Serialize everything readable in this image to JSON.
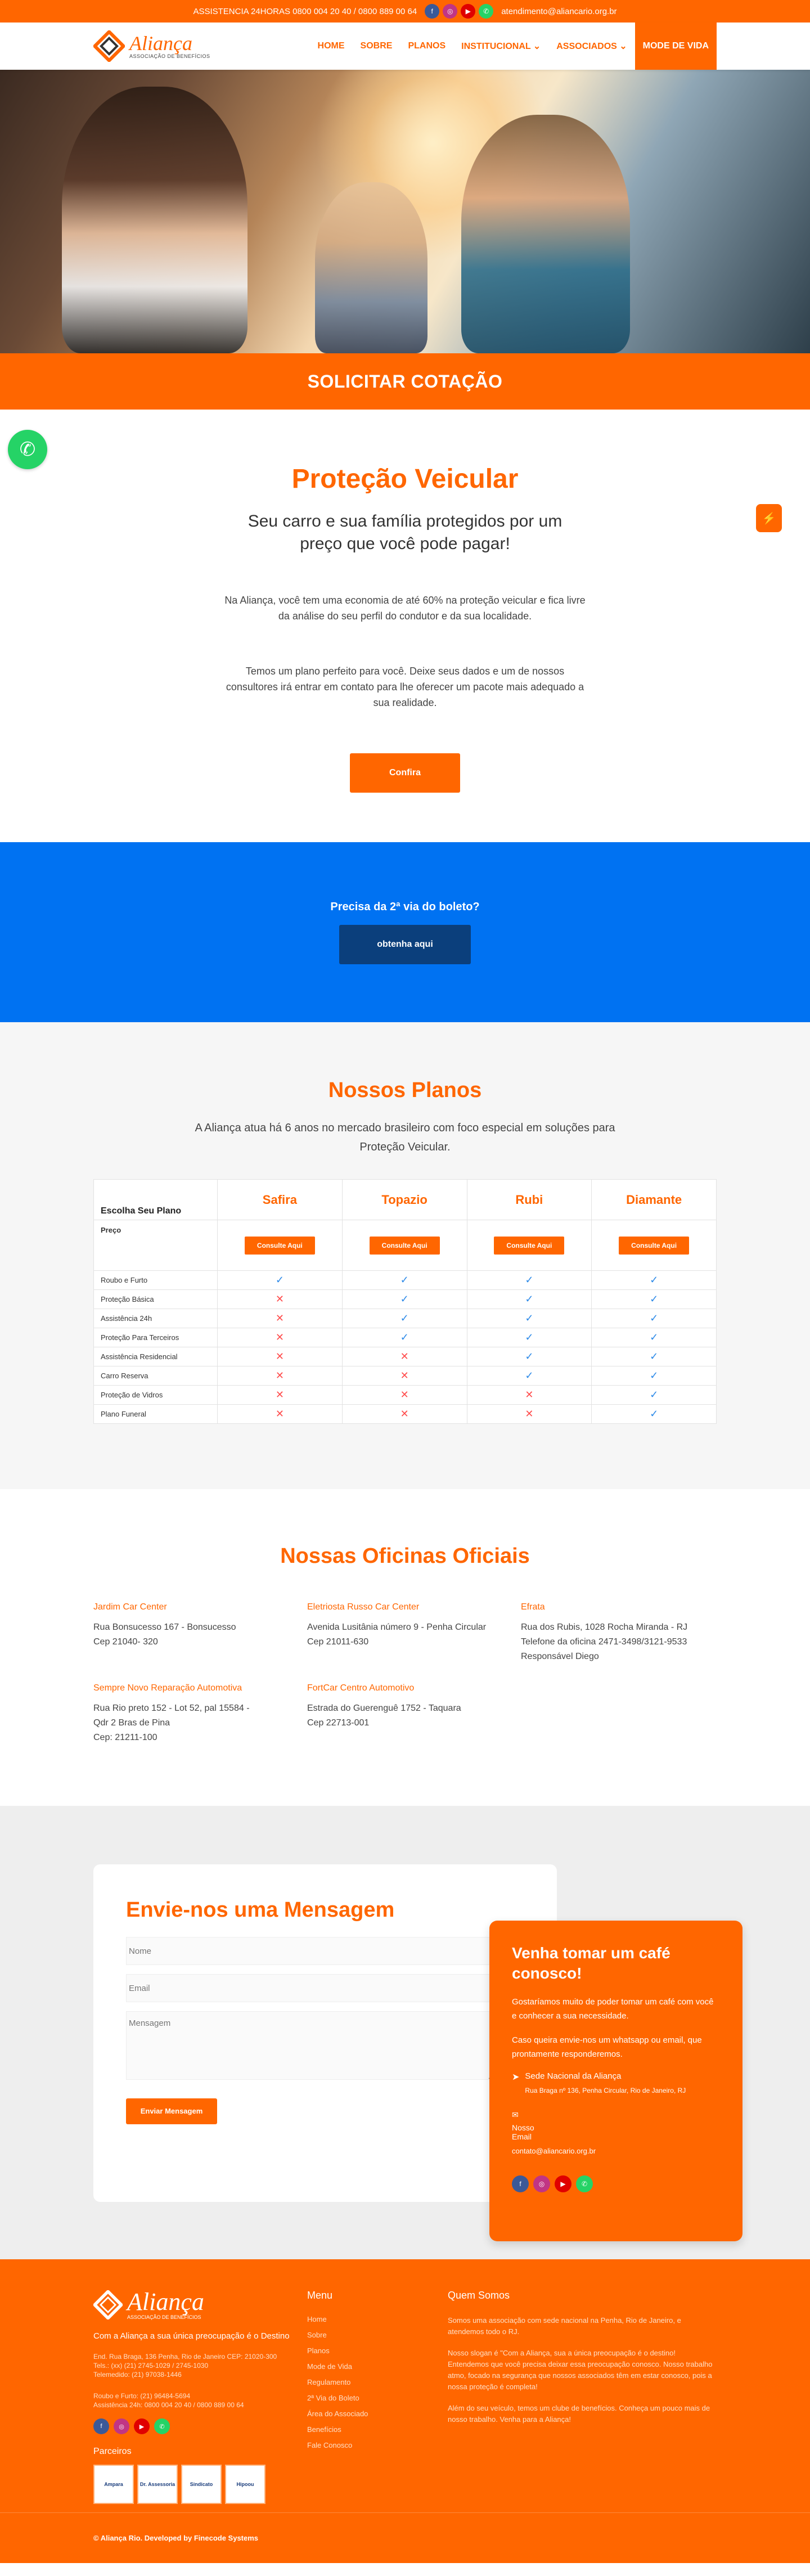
{
  "topbar": {
    "assistance": "ASSISTENCIA 24HORAS 0800 004 20 40 / 0800 889 00 64",
    "email": "atendimento@aliancario.org.br",
    "social": [
      {
        "icon": "facebook-icon",
        "color": "#3b5998"
      },
      {
        "icon": "instagram-icon",
        "color": "#c13584"
      },
      {
        "icon": "youtube-icon",
        "color": "#e00000"
      },
      {
        "icon": "whatsapp-icon",
        "color": "#25d366"
      }
    ]
  },
  "logo": {
    "name": "Aliança",
    "tagline": "ASSOCIAÇÃO DE BENEFÍCIOS"
  },
  "nav": [
    {
      "label": "HOME"
    },
    {
      "label": "SOBRE"
    },
    {
      "label": "PLANOS"
    },
    {
      "label": "INSTITUCIONAL ⌄"
    },
    {
      "label": "ASSOCIADOS ⌄"
    },
    {
      "label": "MODE DE VIDA"
    }
  ],
  "cta": {
    "label": "SOLICITAR COTAÇÃO"
  },
  "intro": {
    "title": "Proteção Veicular",
    "subtitle": "Seu carro e sua família protegidos por um preço que você pode pagar!",
    "p1": "Na Aliança, você tem uma economia de até 60% na proteção veicular e fica livre da análise do seu perfil do condutor e da sua localidade.",
    "p2": "Temos um plano perfeito para você. Deixe seus dados e um de nossos consultores irá entrar em contato para lhe oferecer um pacote mais adequado a sua realidade.",
    "button": "Confira"
  },
  "boleto": {
    "title": "Precisa da 2ª via do boleto?",
    "button": "obtenha aqui"
  },
  "planos": {
    "title": "Nossos Planos",
    "subtitle": "A Aliança atua há 6 anos no mercado brasileiro com foco especial em soluções para Proteção Veicular.",
    "choose_label": "Escolha Seu Plano",
    "price_label": "Preço",
    "button": "Consulte Aqui",
    "plans": [
      "Safira",
      "Topazio",
      "Rubi",
      "Diamante"
    ],
    "features": [
      {
        "name": "Roubo e Furto",
        "v": [
          1,
          1,
          1,
          1
        ]
      },
      {
        "name": "Proteção Básica",
        "v": [
          0,
          1,
          1,
          1
        ]
      },
      {
        "name": "Assistência 24h",
        "v": [
          0,
          1,
          1,
          1
        ]
      },
      {
        "name": "Proteção Para Terceiros",
        "v": [
          0,
          1,
          1,
          1
        ]
      },
      {
        "name": "Assistência Residencial",
        "v": [
          0,
          0,
          1,
          1
        ]
      },
      {
        "name": "Carro Reserva",
        "v": [
          0,
          0,
          1,
          1
        ]
      },
      {
        "name": "Proteção de Vidros",
        "v": [
          0,
          0,
          0,
          1
        ]
      },
      {
        "name": "Plano Funeral",
        "v": [
          0,
          0,
          0,
          1
        ]
      }
    ]
  },
  "oficinas": {
    "title": "Nossas Oficinas Oficiais",
    "items": [
      {
        "name": "Jardim Car Center",
        "lines": [
          "Rua Bonsucesso 167 - Bonsucesso",
          "Cep 21040- 320"
        ]
      },
      {
        "name": "Eletriosta Russo Car Center",
        "lines": [
          "Avenida Lusitânia número 9 - Penha Circular",
          "Cep 21011-630"
        ]
      },
      {
        "name": "Efrata",
        "lines": [
          "Rua dos Rubis, 1028 Rocha Miranda - RJ",
          "Telefone da oficina 2471-3498/3121-9533",
          "Responsável Diego"
        ]
      },
      {
        "name": "Sempre Novo Reparação Automotiva",
        "lines": [
          "Rua Rio preto 152 - Lot 52, pal 15584 - Qdr 2 Bras de Pina",
          "Cep: 21211-100"
        ]
      },
      {
        "name": "FortCar Centro Automotivo",
        "lines": [
          "Estrada do Guerenguê 1752 - Taquara",
          "Cep 22713-001"
        ]
      }
    ]
  },
  "contact": {
    "title": "Envie-nos uma Mensagem",
    "name_ph": "Nome",
    "email_ph": "Email",
    "msg_ph": "Mensagem",
    "button": "Enviar Mensagem",
    "card_title": "Venha tomar um café conosco!",
    "card_p1": "Gostaríamos muito de poder tomar um café com você e conhecer a sua necessidade.",
    "card_p2": "Caso queira envie-nos um whatsapp ou email, que prontamente responderemos.",
    "hq_label": "Sede Nacional da Aliança",
    "hq_addr": "Rua Braga nº 136, Penha Circular, Rio de Janeiro, RJ",
    "email_label1": "Nosso",
    "email_label2": "Email",
    "email": "contato@aliancario.org.br"
  },
  "footer": {
    "tagline": "Com a Aliança a sua única preocupação é o Destino",
    "addr": [
      "End. Rua Braga, 136 Penha, Rio de Janeiro CEP: 21020-300",
      "Tels.: (xx) (21) 2745-1029 / 2745-1030",
      "Telemedido: (21) 97038-1446"
    ],
    "phones": [
      "Roubo e Furto: (21) 96484-5694",
      "Assistência 24h: 0800 004 20 40 / 0800 889 00 64"
    ],
    "partners_label": "Parceiros",
    "partners": [
      "Ampara",
      "Dr. Assessoria",
      "Sindicato",
      "Hipoou"
    ],
    "menu_title": "Menu",
    "menu": [
      "Home",
      "Sobre",
      "Planos",
      "Mode de Vida",
      "Regulamento",
      "2ª Via do Boleto",
      "Área do Associado",
      "Benefícios",
      "Fale Conosco"
    ],
    "about_title": "Quem Somos",
    "about": [
      "Somos uma associação com sede nacional na Penha, Rio de Janeiro, e atendemos todo o RJ.",
      "Nosso slogan é \"Com a Aliança, sua a única preocupação é o destino! Entendemos que você precisa deixar essa preocupação conosco. Nosso trabalho atmo, focado na segurança que nossos associados têm em estar conosco, pois a nossa proteção é completa!",
      "Além do seu veículo, temos um clube de benefícios. Conheça um pouco mais de nosso trabalho. Venha para a Aliança!"
    ],
    "copyright": "© Aliança Rio. Developed by Finecode Systems"
  }
}
